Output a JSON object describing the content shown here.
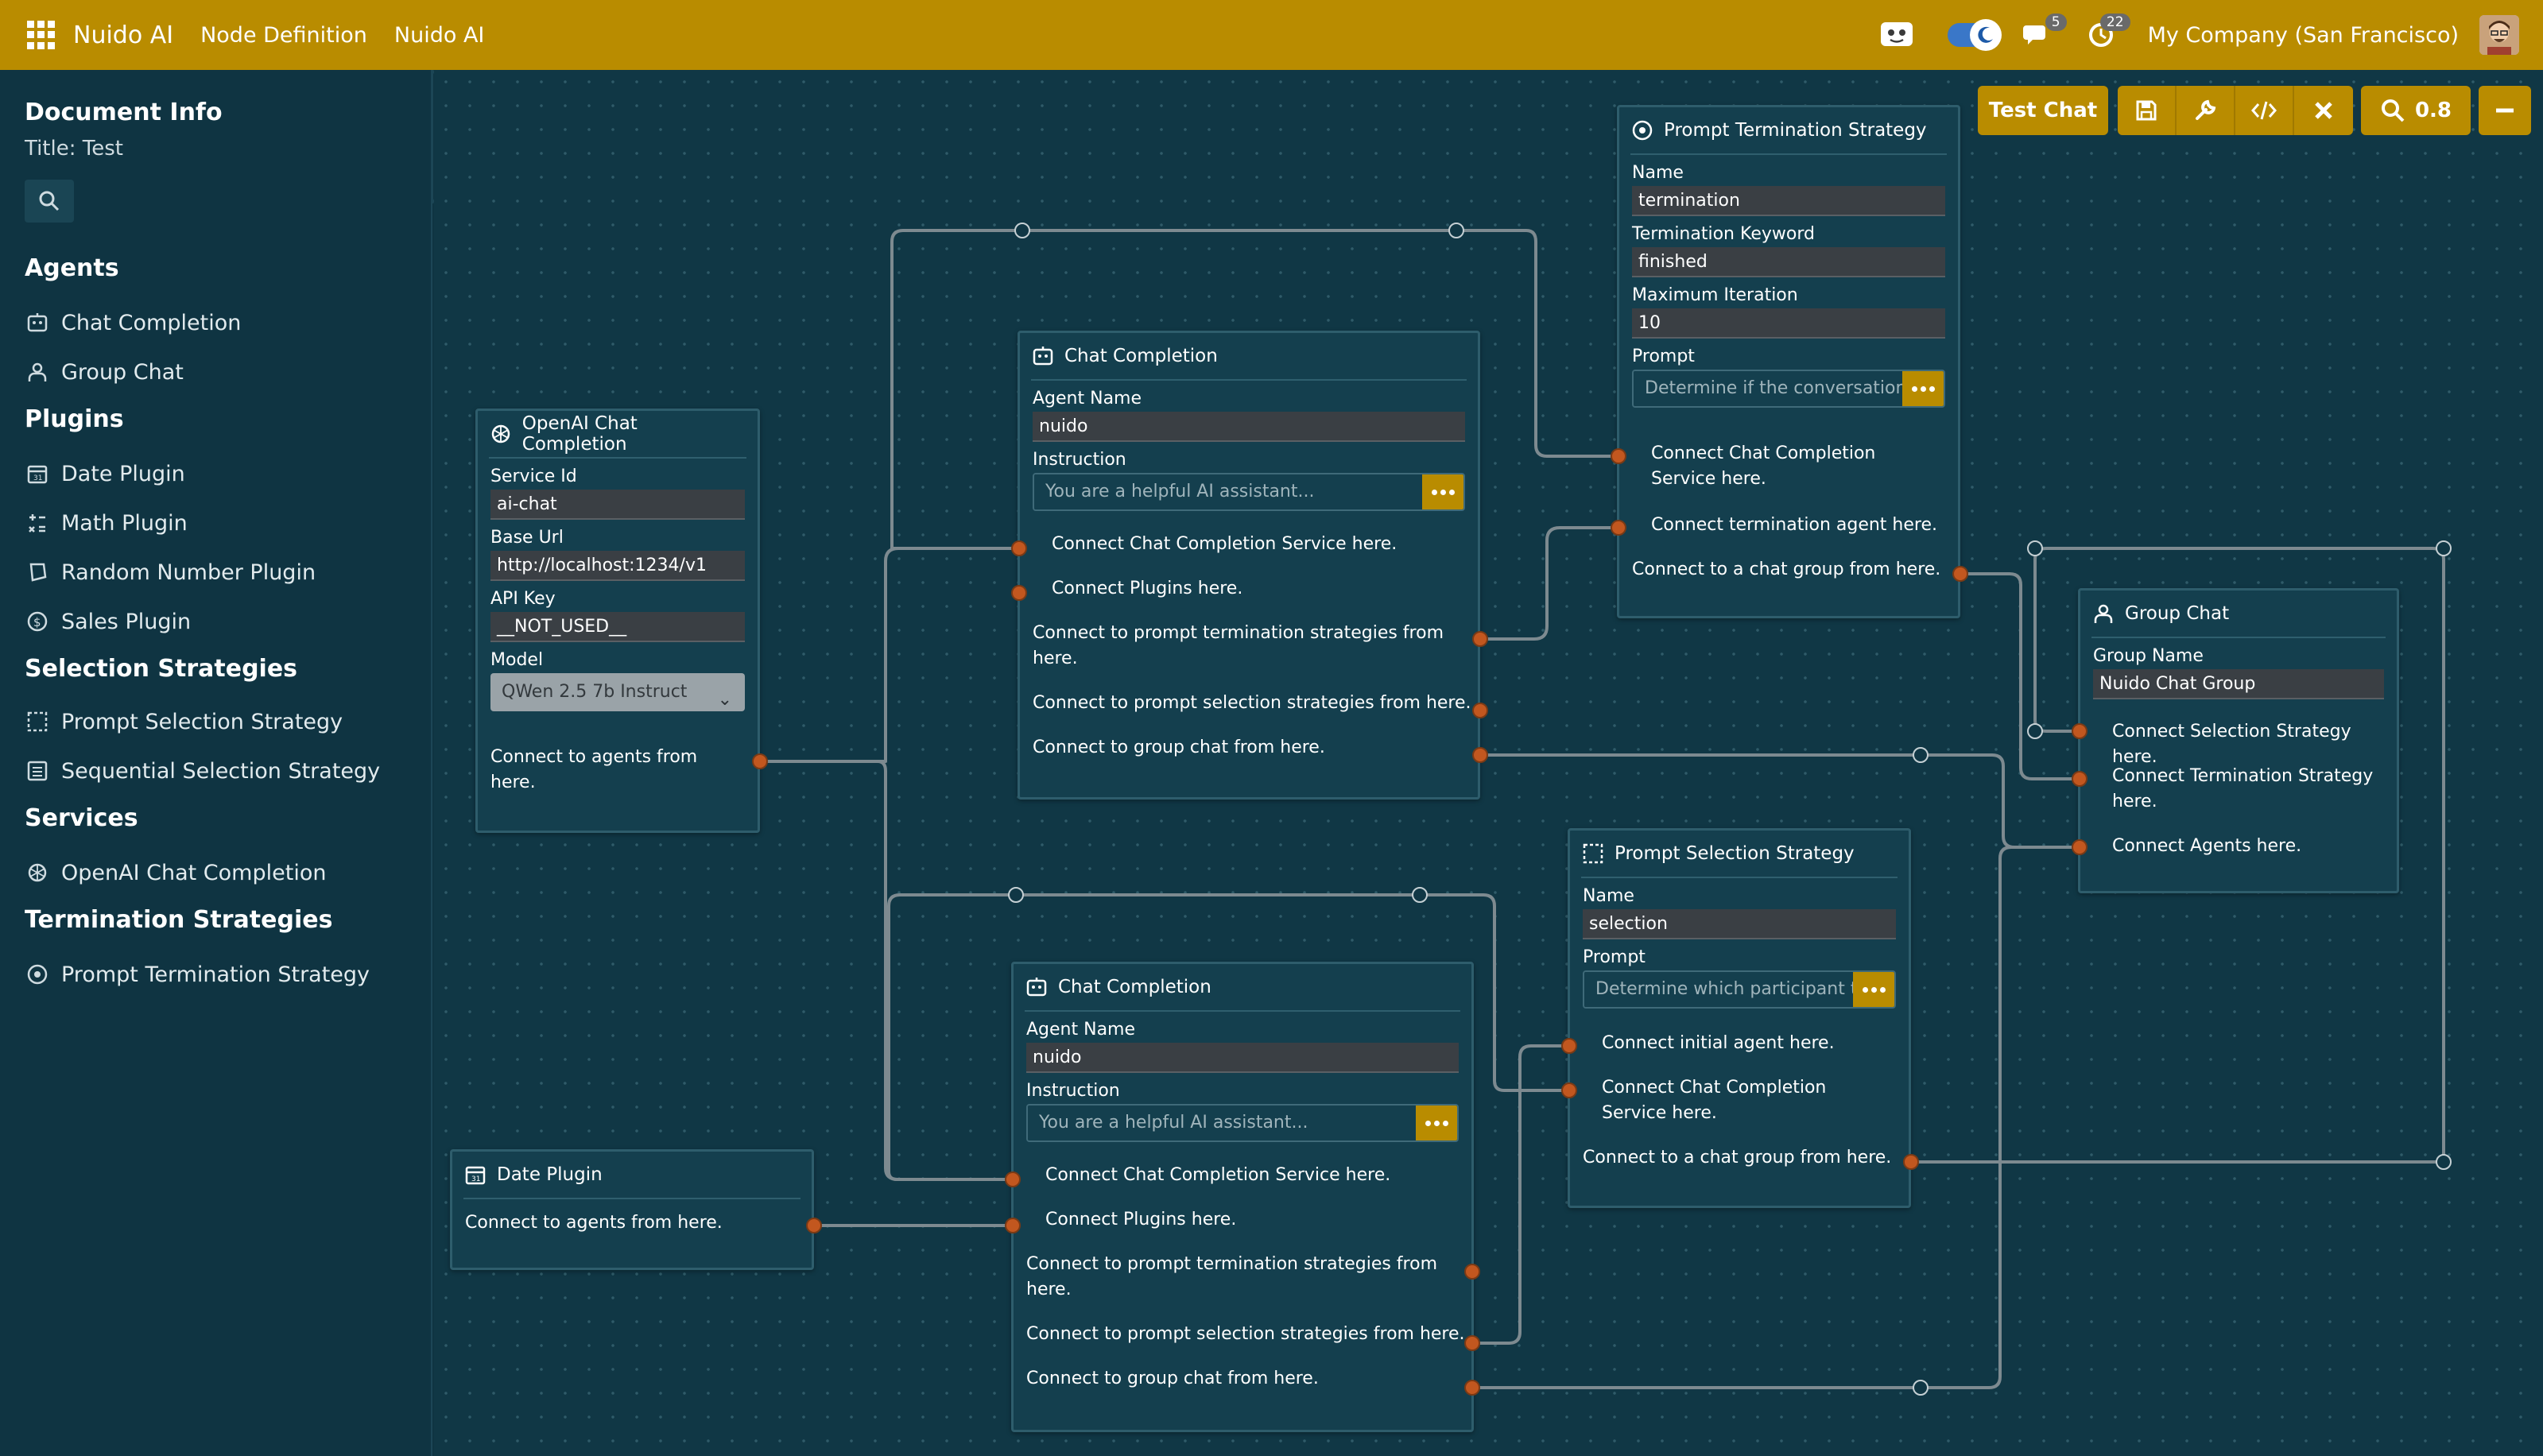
{
  "topbar": {
    "brand": "Nuido AI",
    "menu": [
      "Node Definition",
      "Nuido AI"
    ],
    "messages_count": "5",
    "activity_count": "22",
    "company": "My Company (San Francisco)"
  },
  "sidebar": {
    "doc_heading": "Document Info",
    "doc_title": "Title: Test",
    "sections": {
      "agents": "Agents",
      "plugins": "Plugins",
      "selection": "Selection Strategies",
      "services": "Services",
      "termination": "Termination Strategies"
    },
    "items": {
      "chat_completion": "Chat Completion",
      "group_chat": "Group Chat",
      "date_plugin": "Date Plugin",
      "math_plugin": "Math Plugin",
      "random_plugin": "Random Number Plugin",
      "sales_plugin": "Sales Plugin",
      "prompt_selection": "Prompt Selection Strategy",
      "sequential_selection": "Sequential Selection Strategy",
      "openai_completion": "OpenAI Chat Completion",
      "prompt_termination": "Prompt Termination Strategy"
    }
  },
  "toolbar": {
    "test_chat": "Test Chat",
    "zoom": "0.8"
  },
  "nodes": {
    "openai": {
      "title": "OpenAI Chat Completion",
      "service_id_label": "Service Id",
      "service_id": "ai-chat",
      "base_url_label": "Base Url",
      "base_url": "http://localhost:1234/v1",
      "api_key_label": "API Key",
      "api_key": "__NOT_USED__",
      "model_label": "Model",
      "model": "QWen 2.5 7b Instruct",
      "out_label": "Connect to agents from here."
    },
    "chat1": {
      "title": "Chat Completion",
      "agent_name_label": "Agent Name",
      "agent_name": "nuido",
      "instruction_label": "Instruction",
      "instruction": "You are a helpful AI assistant...",
      "in_service": "Connect Chat Completion Service here.",
      "in_plugins": "Connect Plugins here.",
      "out_termination": "Connect to prompt termination strategies from here.",
      "out_selection": "Connect to prompt selection strategies from here.",
      "out_group": "Connect to group chat from here."
    },
    "chat2": {
      "title": "Chat Completion",
      "agent_name_label": "Agent Name",
      "agent_name": "nuido",
      "instruction_label": "Instruction",
      "instruction": "You are a helpful AI assistant...",
      "in_service": "Connect Chat Completion Service here.",
      "in_plugins": "Connect Plugins here.",
      "out_termination": "Connect to prompt termination strategies from here.",
      "out_selection": "Connect to prompt selection strategies from here.",
      "out_group": "Connect to group chat from here."
    },
    "termination": {
      "title": "Prompt Termination Strategy",
      "name_label": "Name",
      "name": "termination",
      "keyword_label": "Termination Keyword",
      "keyword": "finished",
      "max_label": "Maximum Iteration",
      "max": "10",
      "prompt_label": "Prompt",
      "prompt": "Determine if the conversation.",
      "in_service": "Connect Chat Completion Service here.",
      "in_agent": "Connect termination agent here.",
      "out_group": "Connect to a chat group from here."
    },
    "group": {
      "title": "Group Chat",
      "name_label": "Group Name",
      "name": "Nuido Chat Group",
      "in_selection": "Connect Selection Strategy here.",
      "in_termination": "Connect Termination Strategy here.",
      "in_agents": "Connect Agents here."
    },
    "selection": {
      "title": "Prompt Selection Strategy",
      "name_label": "Name",
      "name": "selection",
      "prompt_label": "Prompt",
      "prompt": "Determine which participant t",
      "in_initial": "Connect initial agent here.",
      "in_service": "Connect Chat Completion Service here.",
      "out_group": "Connect to a chat group from here."
    },
    "date": {
      "title": "Date Plugin",
      "out_label": "Connect to agents from here."
    }
  }
}
